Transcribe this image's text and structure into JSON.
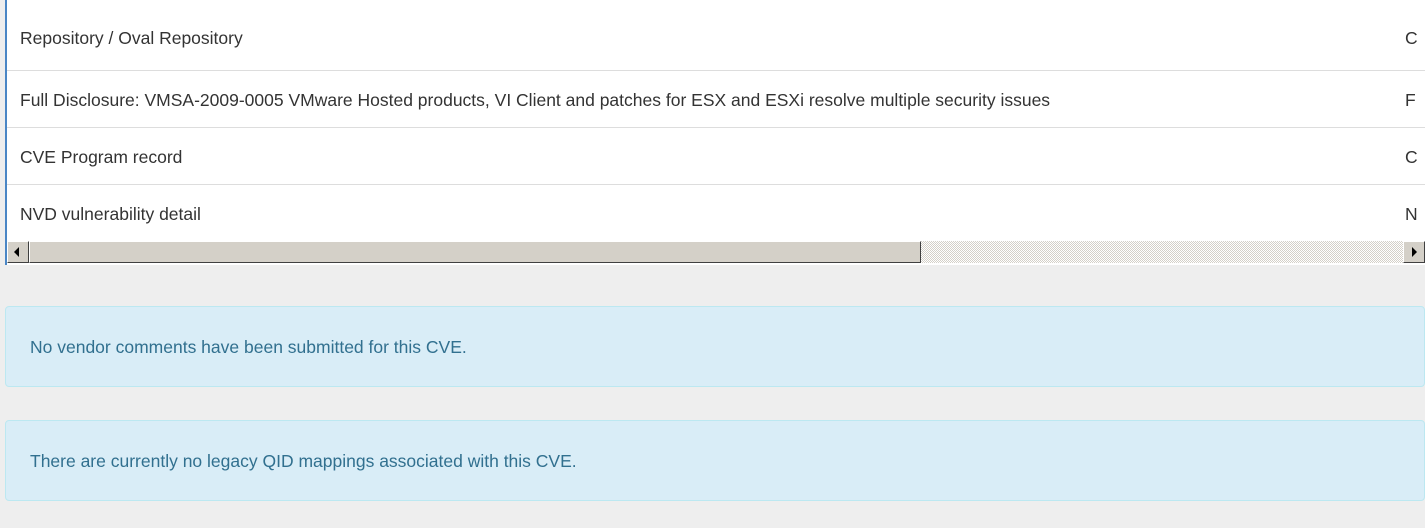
{
  "references": {
    "rows": [
      {
        "name": "Repository / Oval Repository",
        "clipped_source": "C"
      },
      {
        "name": "Full Disclosure: VMSA-2009-0005 VMware Hosted products, VI Client and patches for ESX and ESXi resolve multiple security issues",
        "clipped_source": "F"
      },
      {
        "name": "CVE Program record",
        "clipped_source": "C"
      },
      {
        "name": "NVD vulnerability detail",
        "clipped_source": "N"
      }
    ]
  },
  "vendor_comments": {
    "message": "No vendor comments have been submitted for this CVE."
  },
  "qid_mappings": {
    "message": "There are currently no legacy QID mappings associated with this CVE."
  },
  "icons": {
    "scroll_left": "arrow-left-icon",
    "scroll_right": "arrow-right-icon"
  },
  "colors": {
    "accent_border": "#4a86c5",
    "alert_bg": "#d9edf7",
    "alert_text": "#31708f"
  }
}
